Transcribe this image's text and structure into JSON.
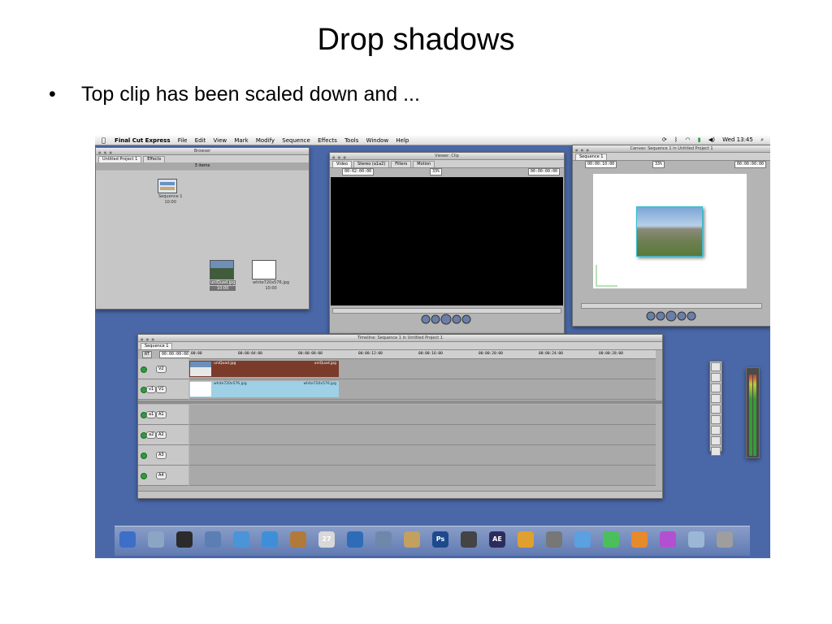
{
  "slide": {
    "title": "Drop shadows",
    "bullet": "Top clip has been scaled down and ..."
  },
  "menubar": {
    "apple": "",
    "app": "Final Cut Express",
    "items": [
      "File",
      "Edit",
      "View",
      "Mark",
      "Modify",
      "Sequence",
      "Effects",
      "Tools",
      "Window",
      "Help"
    ],
    "clock": "Wed 13:45"
  },
  "browser": {
    "title": "Browser",
    "tabs": [
      "Untitled Project 1",
      "Effects"
    ],
    "items_count": "3 items",
    "thumbs": [
      {
        "name": "Sequence 1",
        "duration": "10:00"
      },
      {
        "name": "uniQuad.jpg",
        "duration": "10:00"
      },
      {
        "name": "white720x576.jpg",
        "duration": "10:00"
      }
    ]
  },
  "viewer": {
    "title": "Viewer: Clip",
    "tabs": [
      "Video",
      "Stereo (a1a2)",
      "Filters",
      "Motion"
    ],
    "timecode_left": "00:02:00:00",
    "zoom": "33%",
    "timecode_right": "00:00:00:00"
  },
  "canvas": {
    "title": "Canvas: Sequence 1 in Untitled Project 1",
    "tabs": [
      "Sequence 1"
    ],
    "timecode_left": "00:00:10:00",
    "zoom": "33%",
    "timecode_right": "00:00:00:00"
  },
  "timeline": {
    "title": "Timeline: Sequence 1 in Untitled Project 1",
    "tabs": [
      "Sequence 1"
    ],
    "rt": "RT",
    "timecode": "00:00:00:00",
    "ruler": [
      "00:00",
      "00:00:04:00",
      "00:00:08:00",
      "00:00:12:00",
      "00:00:16:00",
      "00:00:20:00",
      "00:00:24:00",
      "00:00:28:00"
    ],
    "tracks": {
      "v2": "V2",
      "v1_source": "v1",
      "v1": "V1",
      "a1_source": "a1",
      "a1": "A1",
      "a2_source": "a2",
      "a2": "A2",
      "a3": "A3",
      "a4": "A4"
    },
    "clip_top": {
      "name": "uniQuad.jpg",
      "name_end": "uniQuad.jpg",
      "color": "#7a3b2a"
    },
    "clip_bottom": {
      "name": "white720x576.jpg",
      "name_end": "white720x576.jpg",
      "color": "#9ed0e6"
    }
  },
  "dock": {
    "icons": [
      {
        "name": "finder-icon",
        "color": "#3d6fc9",
        "glyph": ""
      },
      {
        "name": "preview-icon",
        "color": "#8aa6c4",
        "glyph": ""
      },
      {
        "name": "dashboard-icon",
        "color": "#2b2b2b",
        "glyph": ""
      },
      {
        "name": "mail-icon",
        "color": "#5b7fb3",
        "glyph": ""
      },
      {
        "name": "safari-icon",
        "color": "#4b94d8",
        "glyph": ""
      },
      {
        "name": "ichat-icon",
        "color": "#3f8fd8",
        "glyph": ""
      },
      {
        "name": "address-book-icon",
        "color": "#b07a3a",
        "glyph": ""
      },
      {
        "name": "ical-icon",
        "color": "#d8d8d8",
        "glyph": "27"
      },
      {
        "name": "itunes-icon",
        "color": "#2d6db7",
        "glyph": ""
      },
      {
        "name": "iphoto-icon",
        "color": "#6d88a8",
        "glyph": ""
      },
      {
        "name": "imovie-icon",
        "color": "#c2a060",
        "glyph": ""
      },
      {
        "name": "photoshop-icon",
        "color": "#1d4a8c",
        "glyph": "Ps"
      },
      {
        "name": "final-cut-icon",
        "color": "#444444",
        "glyph": ""
      },
      {
        "name": "after-effects-icon",
        "color": "#2c2c5c",
        "glyph": "AE"
      },
      {
        "name": "garageband-icon",
        "color": "#e0a030",
        "glyph": ""
      },
      {
        "name": "system-preferences-icon",
        "color": "#777777",
        "glyph": ""
      },
      {
        "name": "folder-blue-icon",
        "color": "#5ba0e0",
        "glyph": ""
      },
      {
        "name": "folder-green-icon",
        "color": "#4bbf5b",
        "glyph": ""
      },
      {
        "name": "folder-orange-icon",
        "color": "#e68a2e",
        "glyph": ""
      },
      {
        "name": "folder-purple-icon",
        "color": "#b34fd1",
        "glyph": ""
      },
      {
        "name": "documents-icon",
        "color": "#9ab7d6",
        "glyph": ""
      },
      {
        "name": "trash-icon",
        "color": "#9e9e9e",
        "glyph": ""
      }
    ]
  }
}
